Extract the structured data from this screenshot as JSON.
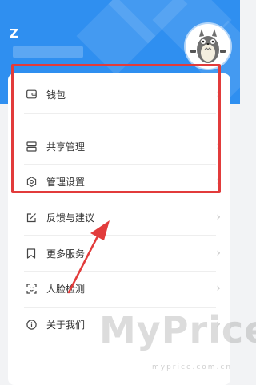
{
  "profile": {
    "username": "Z"
  },
  "menu": {
    "items": [
      {
        "label": "钱包",
        "icon": "wallet-icon"
      },
      {
        "label": "共享管理",
        "icon": "share-manage-icon"
      },
      {
        "label": "管理设置",
        "icon": "settings-icon"
      },
      {
        "label": "反馈与建议",
        "icon": "feedback-icon"
      },
      {
        "label": "更多服务",
        "icon": "bookmark-icon"
      },
      {
        "label": "人脸检测",
        "icon": "face-scan-icon"
      },
      {
        "label": "关于我们",
        "icon": "info-icon"
      }
    ],
    "chevron": "›"
  },
  "annotation": {
    "highlight_color": "#e23b3b"
  },
  "watermark": {
    "brand": "MyPrice",
    "domain": "myprice.com.cn"
  },
  "theme": {
    "header_color": "#2f8ff0",
    "background": "#f2f3f5"
  }
}
